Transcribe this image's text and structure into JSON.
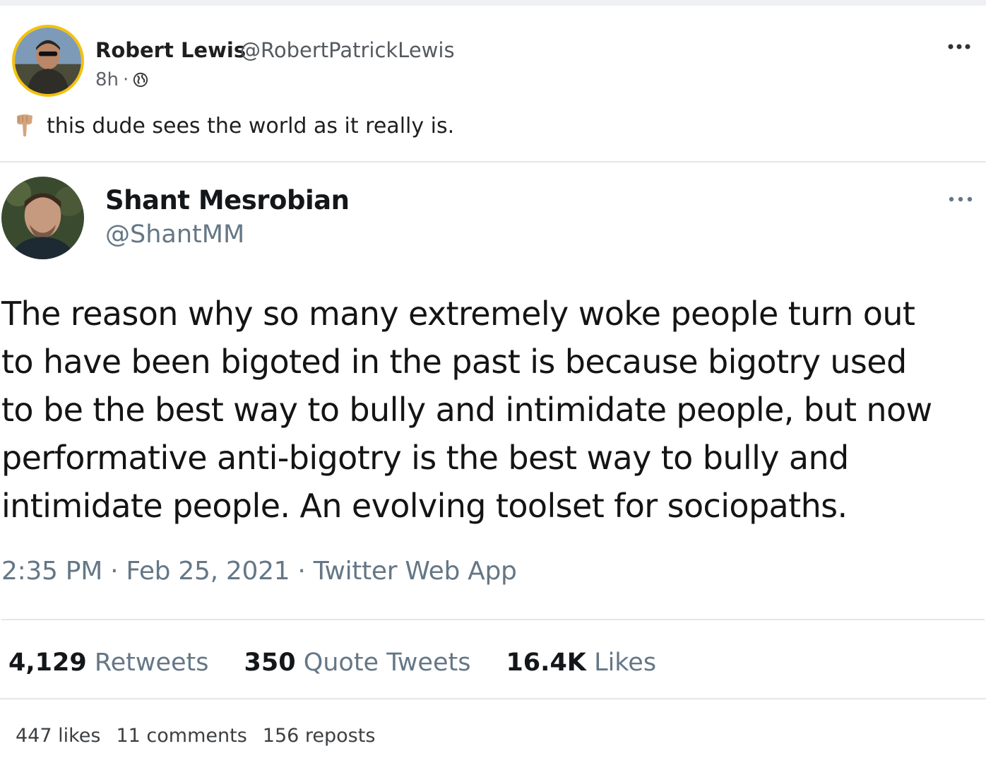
{
  "post": {
    "author_name": "Robert Lewis",
    "author_handle": "@RobertPatrickLewis",
    "time": "8h",
    "separator": "·",
    "visibility_icon": "globe-icon",
    "more_icon": "more-horizontal-icon",
    "caption_emoji_icon": "pointing-down-hand-icon",
    "caption": "this dude sees the world as it really is."
  },
  "embedded_tweet": {
    "name": "Shant Mesrobian",
    "handle": "@ShantMM",
    "more_icon": "more-horizontal-icon",
    "text_lines": [
      "The reason why so many extremely woke people turn out",
      "to have been bigoted in the past is because bigotry used",
      "to be the best way to bully and intimidate people, but now",
      "performative anti-bigotry is the best way to bully and",
      "intimidate people. An evolving toolset for sociopaths."
    ],
    "meta": "2:35 PM · Feb 25, 2021 · Twitter Web App",
    "stats": {
      "retweets_count": "4,129",
      "retweets_label": " Retweets",
      "quotes_count": "350",
      "quotes_label": " Quote Tweets",
      "likes_count": "16.4K",
      "likes_label": " Likes"
    }
  },
  "engagement": {
    "likes": "447 likes",
    "comments": "11 comments",
    "reposts": "156 reposts"
  },
  "colors": {
    "avatar_ring": "#f4c10c",
    "tweet_secondary": "#657786",
    "tweet_primary": "#14171a"
  }
}
